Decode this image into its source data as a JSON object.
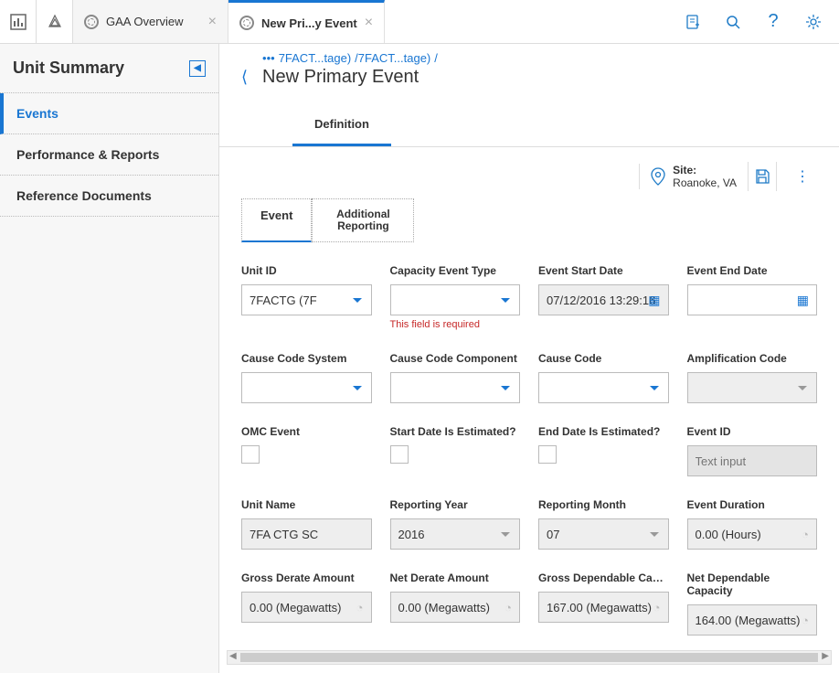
{
  "topbar": {
    "tabs": [
      {
        "label": "GAA Overview"
      },
      {
        "label": "New Pri...y Event"
      }
    ]
  },
  "sidebar": {
    "title": "Unit Summary",
    "items": [
      {
        "label": "Events"
      },
      {
        "label": "Performance & Reports"
      },
      {
        "label": "Reference Documents"
      }
    ]
  },
  "breadcrumb": {
    "dots": "•••",
    "seg1": "7FACT...tage)",
    "seg2": "/7FACT...tage)",
    "tail": "/"
  },
  "page_title": "New Primary Event",
  "def_tab": "Definition",
  "site": {
    "label": "Site:",
    "value": "Roanoke, VA"
  },
  "subtabs": {
    "event": "Event",
    "additional": "Additional Reporting"
  },
  "fields": {
    "unit_id": {
      "label": "Unit ID",
      "value": "7FACTG (7F"
    },
    "capacity_event_type": {
      "label": "Capacity Event Type",
      "error": "This field is required"
    },
    "event_start_date": {
      "label": "Event Start Date",
      "value": "07/12/2016 13:29:16"
    },
    "event_end_date": {
      "label": "Event End Date",
      "value": ""
    },
    "cause_code_system": {
      "label": "Cause Code System"
    },
    "cause_code_component": {
      "label": "Cause Code Component"
    },
    "cause_code": {
      "label": "Cause Code"
    },
    "amplification_code": {
      "label": "Amplification Code"
    },
    "omc_event": {
      "label": "OMC Event"
    },
    "start_estimated": {
      "label": "Start Date Is Estimated?"
    },
    "end_estimated": {
      "label": "End Date Is Estimated?"
    },
    "event_id": {
      "label": "Event ID",
      "placeholder": "Text input"
    },
    "unit_name": {
      "label": "Unit Name",
      "value": "7FA CTG SC"
    },
    "reporting_year": {
      "label": "Reporting Year",
      "value": "2016"
    },
    "reporting_month": {
      "label": "Reporting Month",
      "value": "07"
    },
    "event_duration": {
      "label": "Event Duration",
      "value": "0.00 (Hours)"
    },
    "gross_derate": {
      "label": "Gross Derate Amount",
      "value": "0.00 (Megawatts)"
    },
    "net_derate": {
      "label": "Net Derate Amount",
      "value": "0.00 (Megawatts)"
    },
    "gross_dep": {
      "label": "Gross Dependable Capa...",
      "value": "167.00 (Megawatts)"
    },
    "net_dep": {
      "label": "Net Dependable Capacity",
      "value": "164.00 (Megawatts)"
    }
  }
}
